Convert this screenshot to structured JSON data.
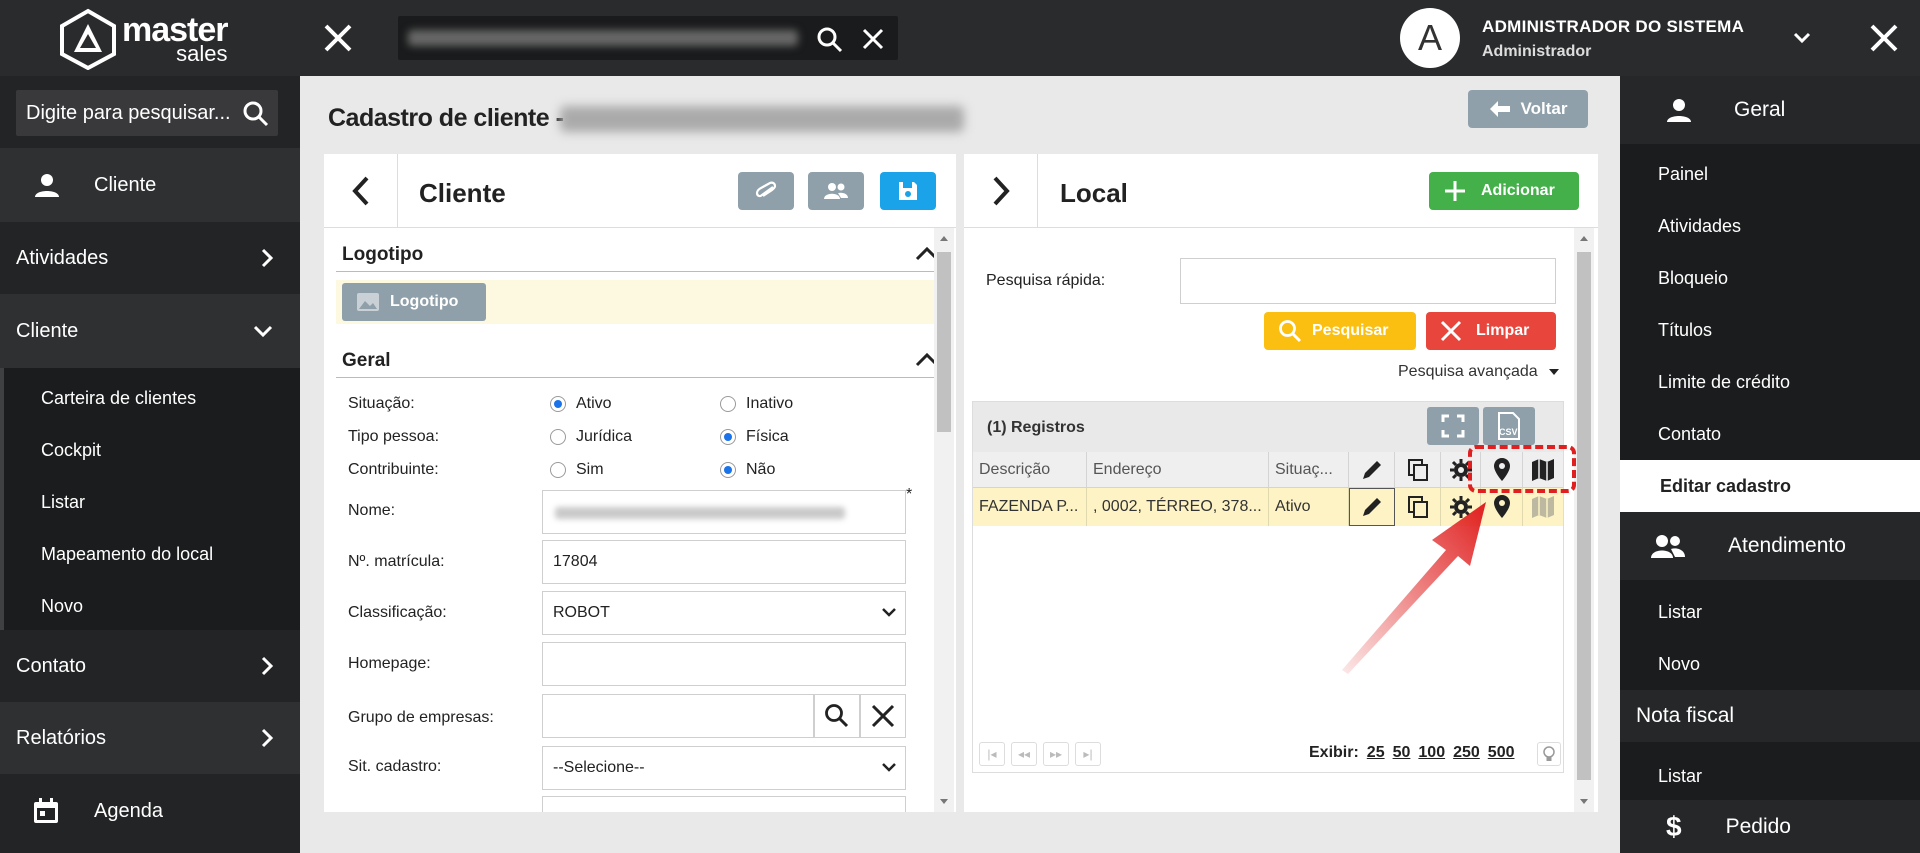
{
  "header": {
    "logo_name": "master",
    "logo_sub": "sales",
    "user_initial": "A",
    "user_name": "ADMINISTRADOR DO SISTEMA",
    "user_role": "Administrador"
  },
  "left_sidebar": {
    "search_placeholder": "Digite para pesquisar...",
    "items": {
      "cliente_top": "Cliente",
      "atividades": "Atividades",
      "cliente": "Cliente",
      "contato": "Contato",
      "relatorios": "Relatórios",
      "agenda": "Agenda"
    },
    "sub_items": [
      "Carteira de clientes",
      "Cockpit",
      "Listar",
      "Mapeamento do local",
      "Novo"
    ]
  },
  "main": {
    "title": "Cadastro de cliente -",
    "back_label": "Voltar"
  },
  "cliente_panel": {
    "title": "Cliente",
    "logotipo_section": "Logotipo",
    "logotipo_button": "Logotipo",
    "geral_section": "Geral",
    "fields": {
      "situacao": "Situação:",
      "tipo_pessoa": "Tipo pessoa:",
      "contribuinte": "Contribuinte:",
      "nome": "Nome:",
      "matricula": "Nº. matrícula:",
      "classificacao": "Classificação:",
      "homepage": "Homepage:",
      "grupo": "Grupo de empresas:",
      "sit_cadastro": "Sit. cadastro:"
    },
    "radio": {
      "ativo": "Ativo",
      "inativo": "Inativo",
      "juridica": "Jurídica",
      "fisica": "Física",
      "sim": "Sim",
      "nao": "Não"
    },
    "required_mark": "*",
    "values": {
      "matricula": "17804",
      "classificacao": "ROBOT",
      "sit_cadastro": "--Selecione--"
    }
  },
  "local_panel": {
    "title": "Local",
    "add_label": "Adicionar",
    "quick_search_label": "Pesquisa rápida:",
    "search_button": "Pesquisar",
    "clear_button": "Limpar",
    "advanced_search": "Pesquisa avançada",
    "records": "(1) Registros",
    "csv_label": "CSV",
    "columns": [
      "Descrição",
      "Endereço",
      "Situaç..."
    ],
    "rows": [
      {
        "descricao": "FAZENDA P...",
        "endereco": ", 0002, TÉRREO, 378...",
        "situacao": "Ativo"
      }
    ],
    "exibir_label": "Exibir:",
    "page_sizes": [
      "25",
      "50",
      "100",
      "250",
      "500"
    ]
  },
  "right_sidebar": {
    "geral": "Geral",
    "geral_items": [
      "Painel",
      "Atividades",
      "Bloqueio",
      "Títulos",
      "Limite de crédito",
      "Contato"
    ],
    "editar": "Editar cadastro",
    "atendimento": "Atendimento",
    "atendimento_items": [
      "Listar",
      "Novo"
    ],
    "nota_fiscal": "Nota fiscal",
    "nota_items": [
      "Listar"
    ],
    "pedido": "Pedido"
  },
  "colors": {
    "dark": "#232425",
    "blue_button": "#1aa3e8",
    "green_button": "#43b049",
    "yellow_button": "#fbbf12",
    "red_button": "#e8453c",
    "highlight": "#e02020"
  }
}
